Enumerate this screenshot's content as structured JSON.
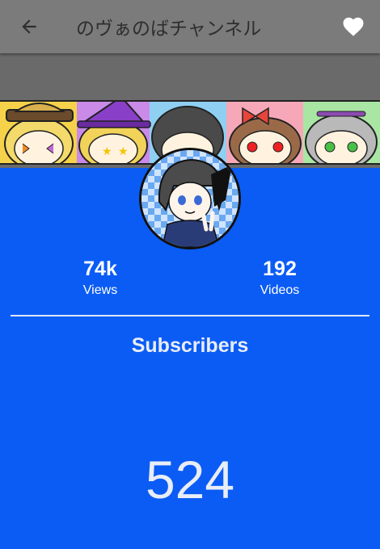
{
  "appbar": {
    "title": "のヴぁのばチャンネル",
    "back_icon": "arrow-left-icon",
    "favorite_icon": "heart-icon"
  },
  "channel": {
    "banner": "character-banner",
    "avatar": "channel-avatar"
  },
  "stats": {
    "views": {
      "value": "74k",
      "label": "Views"
    },
    "videos": {
      "value": "192",
      "label": "Videos"
    }
  },
  "subscribers": {
    "heading": "Subscribers",
    "count": "524"
  },
  "colors": {
    "appbar": "#7b7b7b",
    "background": "#0b5cf5",
    "text": "#ffffff"
  }
}
